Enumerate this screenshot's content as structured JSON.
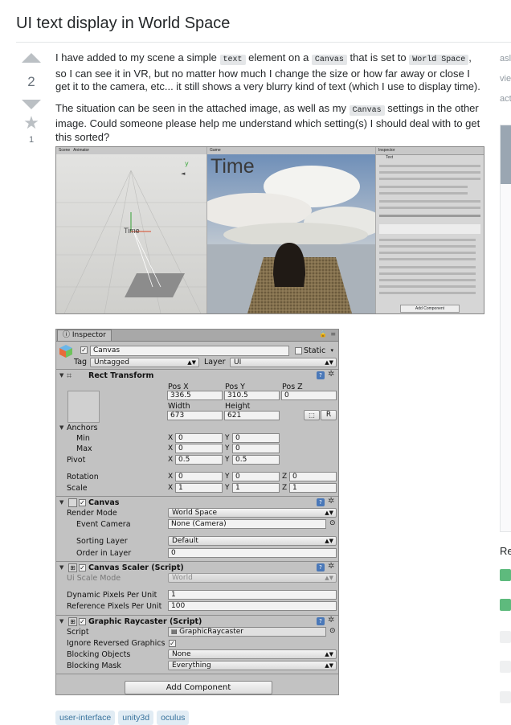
{
  "question": {
    "title": "UI text display in World Space",
    "votes": "2",
    "favorites": "1",
    "p1": {
      "t1": "I have added to my scene a simple ",
      "c1": "text",
      "t2": " element on a ",
      "c2": "Canvas",
      "t3": " that is set to ",
      "c3": "World Space",
      "t4": ", so I can see it in VR, but no matter how much I change the size or how far away or close I get it to the camera, etc... it still shows a very blurry kind of text (which I use to display time)."
    },
    "p2": {
      "t1": "The situation can be seen in the attached image, as well as my ",
      "c1": "Canvas",
      "t2": " settings in the other image. Could someone please help me understand which setting(s) I should deal with to get this sorted?"
    },
    "tags": [
      "user-interface",
      "unity3d",
      "oculus"
    ]
  },
  "sidebar": {
    "asked": "asl",
    "viewed": "vie",
    "active": "act",
    "related_heading": "Re"
  },
  "screenshot1": {
    "scene_tab": "Scene",
    "animator_tab": "Animator",
    "game_tab": "Game",
    "inspector_tab": "Inspector",
    "time_text": "Time",
    "scene_time_text": "Time",
    "obj_name": "Text",
    "add_component": "Add Component"
  },
  "inspector": {
    "tab_label": "Inspector",
    "object_name": "Canvas",
    "static_label": "Static",
    "tag_label": "Tag",
    "tag_value": "Untagged",
    "layer_label": "Layer",
    "layer_value": "UI",
    "rect_transform": {
      "title": "Rect Transform",
      "pos_x_label": "Pos X",
      "pos_y_label": "Pos Y",
      "pos_z_label": "Pos Z",
      "pos_x": "336.5",
      "pos_y": "310.5",
      "pos_z": "0",
      "width_label": "Width",
      "height_label": "Height",
      "width": "673",
      "height": "621",
      "r_button": "R",
      "anchors_label": "Anchors",
      "min_label": "Min",
      "max_label": "Max",
      "min_x": "0",
      "min_y": "0",
      "max_x": "0",
      "max_y": "0",
      "pivot_label": "Pivot",
      "pivot_x": "0.5",
      "pivot_y": "0.5",
      "rotation_label": "Rotation",
      "rot_x": "0",
      "rot_y": "0",
      "rot_z": "0",
      "scale_label": "Scale",
      "scale_x": "1",
      "scale_y": "1",
      "scale_z": "1",
      "x": "X",
      "y": "Y",
      "z": "Z"
    },
    "canvas": {
      "title": "Canvas",
      "render_mode_label": "Render Mode",
      "render_mode": "World Space",
      "event_camera_label": "Event Camera",
      "event_camera": "None (Camera)",
      "sorting_layer_label": "Sorting Layer",
      "sorting_layer": "Default",
      "order_label": "Order in Layer",
      "order": "0"
    },
    "scaler": {
      "title": "Canvas Scaler (Script)",
      "ui_scale_label": "Ui Scale Mode",
      "ui_scale": "World",
      "dynamic_label": "Dynamic Pixels Per Unit",
      "dynamic": "1",
      "reference_label": "Reference Pixels Per Unit",
      "reference": "100"
    },
    "raycaster": {
      "title": "Graphic Raycaster (Script)",
      "script_label": "Script",
      "script": "GraphicRaycaster",
      "ignore_label": "Ignore Reversed Graphics",
      "blocking_objects_label": "Blocking Objects",
      "blocking_objects": "None",
      "blocking_mask_label": "Blocking Mask",
      "blocking_mask": "Everything"
    },
    "add_component": "Add Component"
  }
}
